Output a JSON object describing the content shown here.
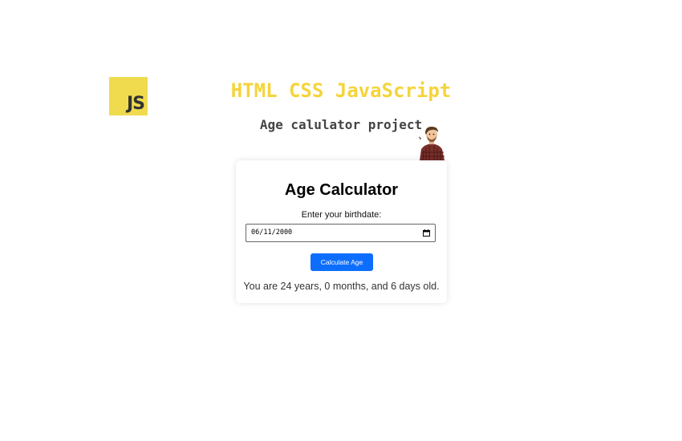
{
  "logo": {
    "text": "JS",
    "background": "#f0db4f",
    "icon": "javascript-logo-icon"
  },
  "header": {
    "title": "HTML CSS JavaScript",
    "subtitle": "Age calulator project",
    "title_color": "#f5d43a",
    "avatar_icon": "person-avatar-icon"
  },
  "calculator": {
    "title": "Age Calculator",
    "birthdate_label": "Enter your birthdate:",
    "birthdate_value": "06/11/2000",
    "calendar_icon": "calendar-icon",
    "button_label": "Calculate Age",
    "button_color": "#0d6efd",
    "result": "You are 24 years, 0 months, and 6 days old."
  }
}
